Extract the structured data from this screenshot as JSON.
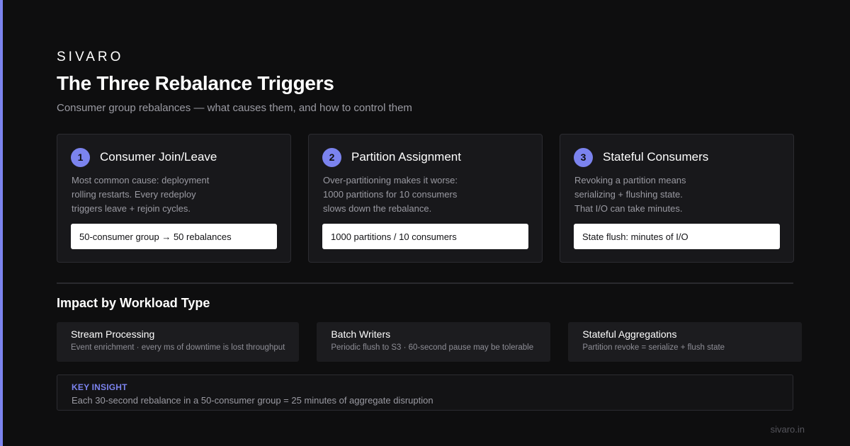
{
  "brand": "SIVARO",
  "title": "The Three Rebalance Triggers",
  "subtitle": "Consumer group rebalances — what causes them, and how to control them",
  "accent_color": "#7b83ee",
  "cards": [
    {
      "number": "1",
      "title": "Consumer Join/Leave",
      "lines": [
        "Most common cause: deployment",
        "rolling restarts. Every redeploy",
        "triggers leave + rejoin cycles."
      ],
      "highlight": "50-consumer group → 50 rebalances"
    },
    {
      "number": "2",
      "title": "Partition Assignment",
      "lines": [
        "Over-partitioning makes it worse:",
        "1000 partitions for 10 consumers",
        "slows down the rebalance."
      ],
      "highlight": "1000 partitions / 10 consumers"
    },
    {
      "number": "3",
      "title": "Stateful Consumers",
      "lines": [
        "Revoking a partition means",
        "serializing + flushing state.",
        "That I/O can take minutes."
      ],
      "highlight": "State flush: minutes of I/O"
    }
  ],
  "impact": {
    "title": "Impact by Workload Type",
    "items": [
      {
        "name": "Stream Processing",
        "desc": "Event enrichment · every ms of downtime is lost throughput"
      },
      {
        "name": "Batch Writers",
        "desc": "Periodic flush to S3 · 60-second pause may be tolerable"
      },
      {
        "name": "Stateful Aggregations",
        "desc": "Partition revoke = serialize + flush state"
      }
    ]
  },
  "insight": {
    "label": "KEY INSIGHT",
    "text": "Each 30-second rebalance in a 50-consumer group = 25 minutes of aggregate disruption"
  },
  "footer_url": "sivaro.in"
}
